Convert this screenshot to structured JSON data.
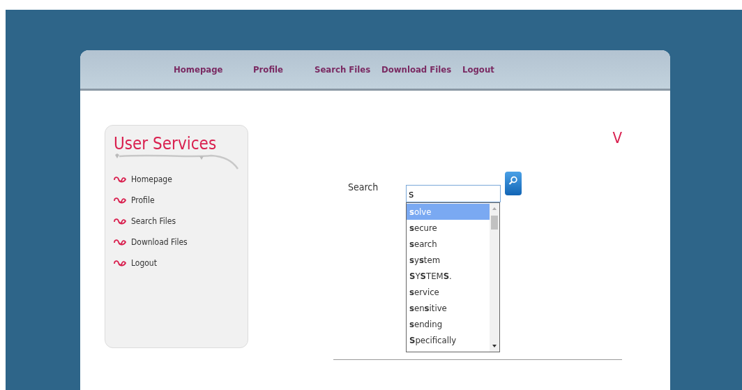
{
  "nav": [
    {
      "label": "Homepage"
    },
    {
      "label": "Profile"
    },
    {
      "label": "Search Files"
    },
    {
      "label": "Download Files"
    },
    {
      "label": "Logout"
    }
  ],
  "sidebar": {
    "title": "User Services",
    "items": [
      {
        "label": "Homepage"
      },
      {
        "label": "Profile"
      },
      {
        "label": "Search Files"
      },
      {
        "label": "Download Files"
      },
      {
        "label": "Logout"
      }
    ]
  },
  "heading_fragment": "V",
  "search": {
    "label": "Search",
    "value": "s"
  },
  "suggestions": [
    {
      "text": "**s**olve",
      "selected": true
    },
    {
      "text": "**s**ecure",
      "selected": false
    },
    {
      "text": "**s**earch",
      "selected": false
    },
    {
      "text": "**s**y**s**tem",
      "selected": false
    },
    {
      "text": "**S**Y**S**TEM**S**.",
      "selected": false
    },
    {
      "text": "**s**ervice",
      "selected": false
    },
    {
      "text": "**s**en**s**itive",
      "selected": false
    },
    {
      "text": "**s**ending",
      "selected": false
    },
    {
      "text": "**S**pecifically",
      "selected": false
    }
  ]
}
